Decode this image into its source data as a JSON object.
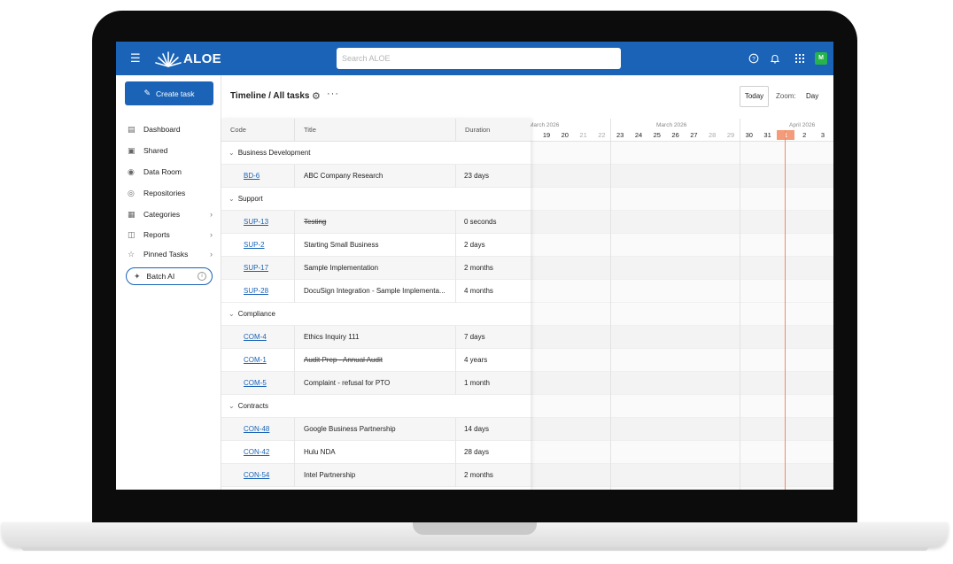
{
  "app": {
    "logo_text": "ALOE",
    "search_placeholder": "Search ALOE",
    "avatar_initial": "M",
    "colors": {
      "primary": "#1a63b7",
      "avatar": "#27b34b",
      "today": "#f39b7a",
      "link": "#1a63b7"
    }
  },
  "sidebar": {
    "create_label": "Create task",
    "items": [
      {
        "label": "Dashboard",
        "icon": "dashboard-icon"
      },
      {
        "label": "Shared",
        "icon": "shared-folder-icon"
      },
      {
        "label": "Data Room",
        "icon": "globe-icon"
      },
      {
        "label": "Repositories",
        "icon": "repository-icon"
      },
      {
        "label": "Categories",
        "icon": "categories-icon"
      },
      {
        "label": "Reports",
        "icon": "reports-icon"
      },
      {
        "label": "Pinned Tasks",
        "icon": "pin-icon"
      }
    ],
    "batch_label": "Batch AI"
  },
  "header": {
    "title_main": "Timeline",
    "title_sep": " / ",
    "title_sub": "All tasks",
    "today_label": "Today",
    "zoom_label": "Zoom:",
    "zoom_value": "Day"
  },
  "table": {
    "columns": [
      "Code",
      "Title",
      "Duration"
    ],
    "groups": [
      {
        "name": "Business Development",
        "tasks": [
          {
            "code": "BD-6",
            "title": "ABC Company Research",
            "duration": "23 days",
            "strike": false
          }
        ]
      },
      {
        "name": "Support",
        "tasks": [
          {
            "code": "SUP-13",
            "title": "Testing",
            "duration": "0 seconds",
            "strike": true
          },
          {
            "code": "SUP-2",
            "title": "Starting Small Business",
            "duration": "2 days",
            "strike": false
          },
          {
            "code": "SUP-17",
            "title": "Sample Implementation",
            "duration": "2 months",
            "strike": false
          },
          {
            "code": "SUP-28",
            "title": "DocuSign Integration - Sample Implementa...",
            "duration": "4 months",
            "strike": false
          }
        ]
      },
      {
        "name": "Compliance",
        "tasks": [
          {
            "code": "COM-4",
            "title": "Ethics Inquiry 111",
            "duration": "7 days",
            "strike": false
          },
          {
            "code": "COM-1",
            "title": "Audit Prep - Annual Audit",
            "duration": "4 years",
            "strike": true
          },
          {
            "code": "COM-5",
            "title": "Complaint - refusal for PTO",
            "duration": "1 month",
            "strike": false
          }
        ]
      },
      {
        "name": "Contracts",
        "tasks": [
          {
            "code": "CON-48",
            "title": "Google Business Partnership",
            "duration": "14 days",
            "strike": false
          },
          {
            "code": "CON-42",
            "title": "Hulu NDA",
            "duration": "28 days",
            "strike": false
          },
          {
            "code": "CON-54",
            "title": "Intel Partnership",
            "duration": "2 months",
            "strike": false
          }
        ]
      }
    ]
  },
  "timeline": {
    "months": [
      "March 2026",
      "March 2026",
      "April 2026"
    ],
    "days": [
      {
        "d": "19",
        "weekend": false
      },
      {
        "d": "20",
        "weekend": false
      },
      {
        "d": "21",
        "weekend": true
      },
      {
        "d": "22",
        "weekend": true
      },
      {
        "d": "23",
        "weekend": false
      },
      {
        "d": "24",
        "weekend": false
      },
      {
        "d": "25",
        "weekend": false
      },
      {
        "d": "26",
        "weekend": false
      },
      {
        "d": "27",
        "weekend": false
      },
      {
        "d": "28",
        "weekend": true
      },
      {
        "d": "29",
        "weekend": true
      },
      {
        "d": "30",
        "weekend": false
      },
      {
        "d": "31",
        "weekend": false
      },
      {
        "d": "1",
        "weekend": false,
        "today": true
      },
      {
        "d": "2",
        "weekend": false
      },
      {
        "d": "3",
        "weekend": false
      }
    ]
  }
}
